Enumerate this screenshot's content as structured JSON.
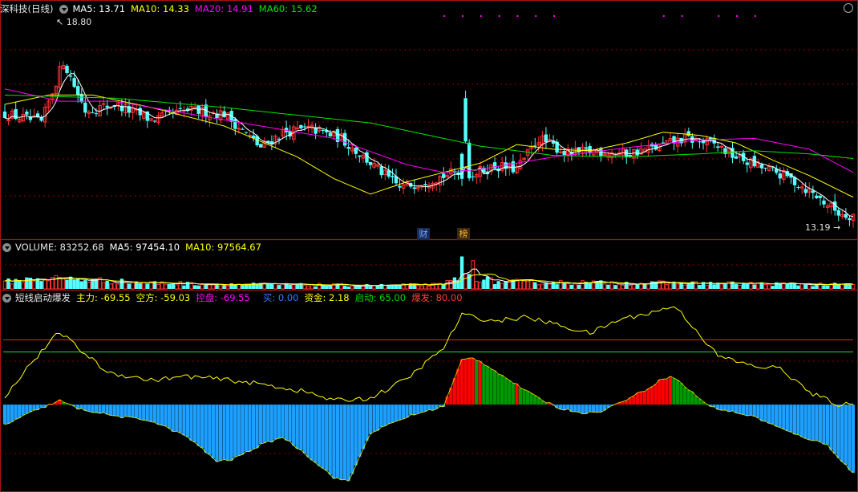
{
  "colors": {
    "up": "#ff3232",
    "down": "#54ffff",
    "ma5": "#ffffff",
    "ma10": "#ffff00",
    "ma20": "#ff00ff",
    "ma60": "#00e600",
    "grid": "#8b0000",
    "border": "#b01010",
    "vol_ma5": "#ffffff",
    "vol_ma10": "#ffff00",
    "zhuli": "#ffff00",
    "kongfang": "#ffffff",
    "kongpan": "#ff00ff",
    "buy": "#3c78ff",
    "zijin": "#ffff00",
    "qidong": "#00d200",
    "baofa": "#ff3c3c",
    "bar_red": "#ff0000",
    "bar_green": "#009900",
    "bar_blue": "#1ea0ff",
    "line_red": "#ff2020",
    "line_green": "#22dd22"
  },
  "price_header": {
    "title": "深科技(日线)",
    "ma5": "MA5: 13.71",
    "ma10": "MA10: 14.33",
    "ma20": "MA20: 14.91",
    "ma60": "MA60: 15.62"
  },
  "vol_header": {
    "title": "VOLUME: 83252.68",
    "ma5": "MA5: 97454.10",
    "ma10": "MA10: 97564.67"
  },
  "ind_header": {
    "title": "短线启动爆发",
    "zhuli": "主力: -69.55",
    "kongfang": "空方: -59.03",
    "kongpan": "控盘: -69.55",
    "mai": "买: 0.00",
    "zijin": "资金: 2.18",
    "qidong": "启动: 65.00",
    "baofa": "爆发: 80.00"
  },
  "price_labels": {
    "high": "18.80",
    "low": "13.19"
  },
  "markers": {
    "cai": "财",
    "bang": "榜"
  },
  "chart_data": [
    {
      "type": "candlestick",
      "title": "深科技(日线)",
      "ylim": [
        12.6,
        19.6
      ],
      "series": [
        "MA5",
        "MA10",
        "MA20",
        "MA60"
      ],
      "close_path": [
        [
          0,
          16.5
        ],
        [
          10,
          16.2
        ],
        [
          16,
          18.2
        ],
        [
          22,
          16.6
        ],
        [
          30,
          16.8
        ],
        [
          40,
          16.3
        ],
        [
          50,
          16.6
        ],
        [
          60,
          16.5
        ],
        [
          70,
          15.4
        ],
        [
          76,
          15.9
        ],
        [
          84,
          16.0
        ],
        [
          92,
          15.7
        ],
        [
          100,
          14.9
        ],
        [
          108,
          14.1
        ],
        [
          114,
          14.3
        ],
        [
          122,
          14.55
        ],
        [
          128,
          14.55
        ],
        [
          134,
          14.8
        ],
        [
          140,
          14.7
        ],
        [
          146,
          15.7
        ],
        [
          154,
          15.2
        ],
        [
          162,
          15.3
        ],
        [
          170,
          15.2
        ],
        [
          178,
          15.4
        ],
        [
          186,
          15.7
        ],
        [
          194,
          15.5
        ],
        [
          200,
          15.1
        ],
        [
          206,
          14.8
        ],
        [
          214,
          14.45
        ],
        [
          220,
          14.0
        ],
        [
          228,
          13.3
        ],
        [
          232,
          13.2
        ]
      ],
      "ma60_path": [
        [
          0,
          17.1
        ],
        [
          30,
          17.0
        ],
        [
          60,
          16.7
        ],
        [
          100,
          16.2
        ],
        [
          130,
          15.45
        ],
        [
          150,
          15.15
        ],
        [
          170,
          15.1
        ],
        [
          190,
          15.2
        ],
        [
          205,
          15.3
        ],
        [
          220,
          15.2
        ],
        [
          232,
          15.05
        ]
      ],
      "ma20_path": [
        [
          0,
          17.3
        ],
        [
          15,
          16.9
        ],
        [
          30,
          16.9
        ],
        [
          50,
          16.5
        ],
        [
          70,
          16.1
        ],
        [
          90,
          15.7
        ],
        [
          110,
          14.85
        ],
        [
          120,
          14.6
        ],
        [
          130,
          14.7
        ],
        [
          140,
          14.9
        ],
        [
          150,
          15.1
        ],
        [
          170,
          15.4
        ],
        [
          190,
          15.65
        ],
        [
          205,
          15.7
        ],
        [
          220,
          15.35
        ],
        [
          232,
          14.6
        ]
      ],
      "ma10_path": [
        [
          0,
          16.8
        ],
        [
          12,
          17.1
        ],
        [
          24,
          17.1
        ],
        [
          40,
          16.7
        ],
        [
          60,
          16.1
        ],
        [
          80,
          15.1
        ],
        [
          90,
          14.4
        ],
        [
          100,
          13.9
        ],
        [
          110,
          14.3
        ],
        [
          120,
          14.6
        ],
        [
          130,
          14.9
        ],
        [
          140,
          15.5
        ],
        [
          150,
          15.35
        ],
        [
          160,
          15.3
        ],
        [
          170,
          15.55
        ],
        [
          180,
          15.9
        ],
        [
          190,
          15.8
        ],
        [
          200,
          15.55
        ],
        [
          210,
          15.0
        ],
        [
          220,
          14.5
        ],
        [
          232,
          13.8
        ]
      ],
      "high": 18.8,
      "low": 13.19
    },
    {
      "type": "bar",
      "title": "VOLUME",
      "series": [
        "VOLUME",
        "MA5",
        "MA10"
      ],
      "vol_path": [
        [
          0,
          0.6
        ],
        [
          10,
          0.9
        ],
        [
          20,
          0.8
        ],
        [
          40,
          0.5
        ],
        [
          60,
          0.4
        ],
        [
          80,
          0.35
        ],
        [
          100,
          0.3
        ],
        [
          120,
          0.35
        ],
        [
          125,
          1.2
        ],
        [
          128,
          1.1
        ],
        [
          134,
          0.6
        ],
        [
          150,
          0.55
        ],
        [
          170,
          0.5
        ],
        [
          200,
          0.45
        ],
        [
          232,
          0.35
        ]
      ],
      "ylim": [
        0,
        3.2
      ],
      "value": 83252.68
    },
    {
      "type": "bar",
      "title": "短线启动爆发",
      "ylim": [
        -105,
        125
      ],
      "series": [
        "主力",
        "空方",
        "控盘",
        "启动",
        "爆发"
      ],
      "zhuli_path": [
        [
          0,
          -25
        ],
        [
          8,
          -8
        ],
        [
          15,
          5
        ],
        [
          20,
          -5
        ],
        [
          30,
          -14
        ],
        [
          40,
          -20
        ],
        [
          50,
          -40
        ],
        [
          58,
          -70
        ],
        [
          62,
          -68
        ],
        [
          70,
          -50
        ],
        [
          76,
          -40
        ],
        [
          82,
          -60
        ],
        [
          90,
          -90
        ],
        [
          94,
          -95
        ],
        [
          100,
          -35
        ],
        [
          110,
          -15
        ],
        [
          120,
          -2
        ],
        [
          125,
          55
        ],
        [
          128,
          58
        ],
        [
          132,
          48
        ],
        [
          136,
          36
        ],
        [
          145,
          10
        ],
        [
          152,
          -5
        ],
        [
          158,
          -10
        ],
        [
          162,
          -10
        ],
        [
          168,
          2
        ],
        [
          176,
          20
        ],
        [
          180,
          33
        ],
        [
          183,
          34
        ],
        [
          186,
          22
        ],
        [
          193,
          -3
        ],
        [
          205,
          -15
        ],
        [
          215,
          -35
        ],
        [
          225,
          -50
        ],
        [
          232,
          -85
        ]
      ],
      "kongfang_path": [
        [
          0,
          8
        ],
        [
          5,
          40
        ],
        [
          15,
          90
        ],
        [
          20,
          70
        ],
        [
          28,
          40
        ],
        [
          40,
          30
        ],
        [
          50,
          35
        ],
        [
          62,
          30
        ],
        [
          72,
          24
        ],
        [
          82,
          16
        ],
        [
          90,
          5
        ],
        [
          100,
          8
        ],
        [
          110,
          32
        ],
        [
          120,
          70
        ],
        [
          125,
          111
        ],
        [
          134,
          103
        ],
        [
          142,
          108
        ],
        [
          150,
          100
        ],
        [
          160,
          88
        ],
        [
          168,
          105
        ],
        [
          178,
          115
        ],
        [
          183,
          122
        ],
        [
          186,
          108
        ],
        [
          195,
          60
        ],
        [
          205,
          47
        ],
        [
          212,
          45
        ],
        [
          220,
          15
        ],
        [
          228,
          0
        ],
        [
          232,
          0
        ]
      ],
      "qidong": 65,
      "baofa": 80
    }
  ]
}
